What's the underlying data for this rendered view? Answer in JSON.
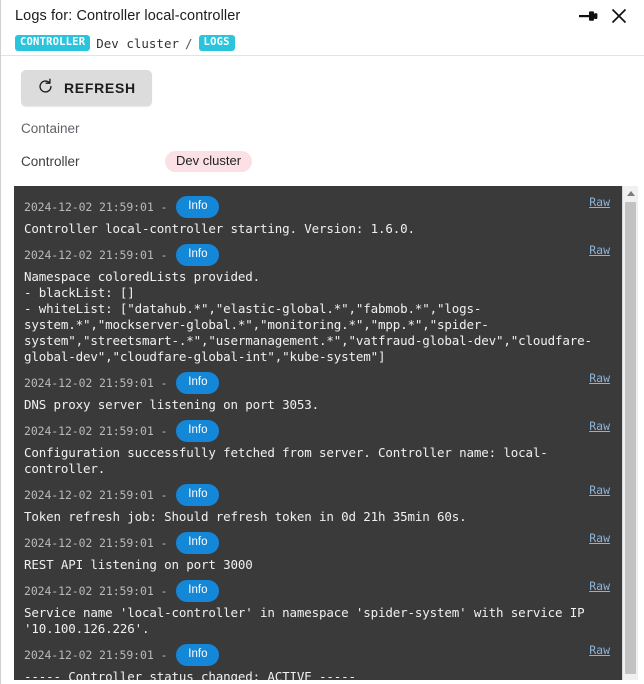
{
  "window": {
    "title": "Logs for: Controller local-controller",
    "pin_icon": "pin-icon",
    "close_icon": "close-icon"
  },
  "breadcrumb": {
    "kind_badge": "CONTROLLER",
    "cluster": "Dev cluster",
    "separator": "/",
    "section_badge": "LOGS"
  },
  "toolbar": {
    "refresh_label": "REFRESH",
    "refresh_icon": "refresh-icon"
  },
  "meta": {
    "container_label": "Container",
    "container_value": "",
    "controller_label": "Controller",
    "controller_value": "Dev cluster"
  },
  "colors": {
    "accent_cyan": "#2bc4dd",
    "info_blue": "#1487d8",
    "chip_pink": "#fbe0e6",
    "log_background": "#3a3a3a",
    "raw_link": "#8ab4d8"
  },
  "logs": {
    "raw_label": "Raw",
    "entries": [
      {
        "timestamp": "2024-12-02 21:59:01 -",
        "level": "Info",
        "message": "Controller local-controller starting. Version: 1.6.0."
      },
      {
        "timestamp": "2024-12-02 21:59:01 -",
        "level": "Info",
        "message": "Namespace coloredLists provided.\n- blackList: []\n- whiteList: [\"datahub.*\",\"elastic-global.*\",\"fabmob.*\",\"logs-system.*\",\"mockserver-global.*\",\"monitoring.*\",\"mpp.*\",\"spider-system\",\"streetsmart-.*\",\"usermanagement.*\",\"vatfraud-global-dev\",\"cloudfare-global-dev\",\"cloudfare-global-int\",\"kube-system\"]"
      },
      {
        "timestamp": "2024-12-02 21:59:01 -",
        "level": "Info",
        "message": "DNS proxy server listening on port 3053."
      },
      {
        "timestamp": "2024-12-02 21:59:01 -",
        "level": "Info",
        "message": "Configuration successfully fetched from server. Controller name: local-controller."
      },
      {
        "timestamp": "2024-12-02 21:59:01 -",
        "level": "Info",
        "message": "Token refresh job: Should refresh token in 0d 21h 35min 60s."
      },
      {
        "timestamp": "2024-12-02 21:59:01 -",
        "level": "Info",
        "message": "REST API listening on port 3000"
      },
      {
        "timestamp": "2024-12-02 21:59:01 -",
        "level": "Info",
        "message": "Service name 'local-controller' in namespace 'spider-system' with service IP '10.100.126.226'."
      },
      {
        "timestamp": "2024-12-02 21:59:01 -",
        "level": "Info",
        "message": "----- Controller status changed: ACTIVE -----"
      }
    ]
  },
  "scrollbar": {
    "up_arrow_icon": "chevron-up-icon"
  }
}
